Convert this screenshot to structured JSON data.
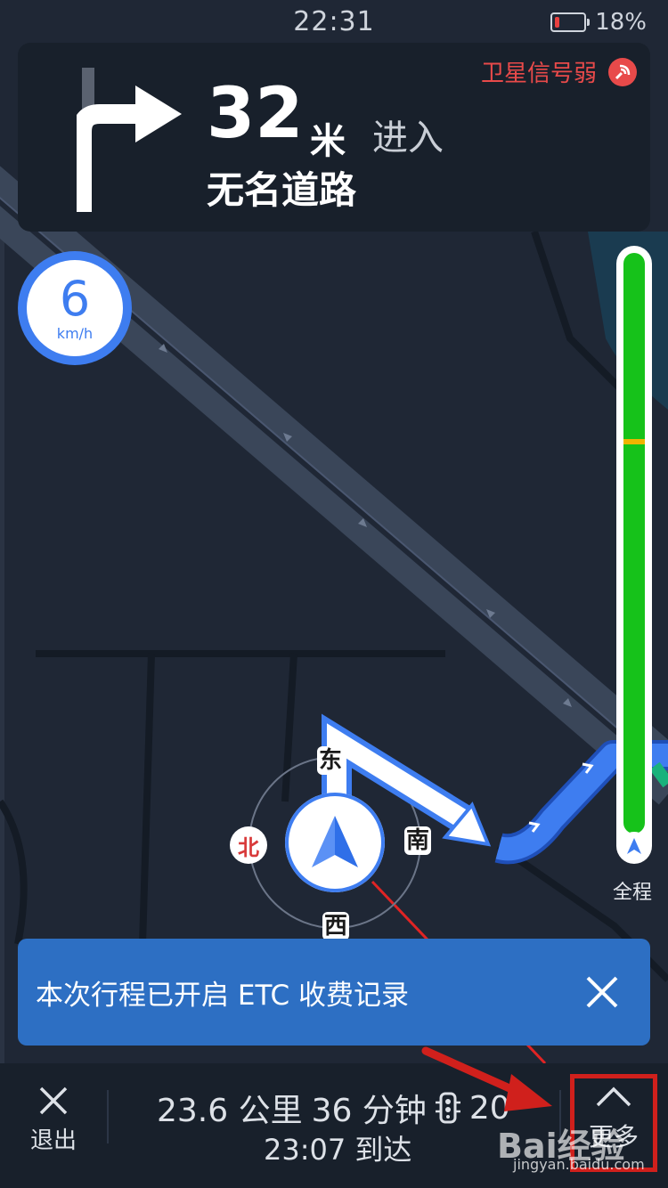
{
  "status": {
    "time": "22:31",
    "battery_percent": "18%",
    "battery_level": 0.18
  },
  "nav": {
    "distance": "32",
    "distance_unit": "米",
    "action": "进入",
    "road": "无名道路",
    "gps_warning": "卫星信号弱"
  },
  "speed": {
    "value": "6",
    "unit": "km/h"
  },
  "compass": {
    "east": "东",
    "south": "南",
    "west": "西",
    "north": "北"
  },
  "progress": {
    "label": "全程",
    "traveled_fraction": 0.32
  },
  "toast": {
    "text": "本次行程已开启 ETC 收费记录"
  },
  "bottom": {
    "exit_label": "退出",
    "distance": "23.6 公里",
    "duration": "36 分钟",
    "lights": "20",
    "arrival": "23:07 到达",
    "more_label": "更多"
  },
  "watermark": {
    "brand": "Bai经验",
    "url": "jingyan.baidu.com"
  },
  "colors": {
    "route": "#3e7df0",
    "progress_green": "#16c21a",
    "warning_red": "#e84a4a",
    "toast_blue": "#2d6fc3",
    "highlight_box": "#d0201c"
  }
}
